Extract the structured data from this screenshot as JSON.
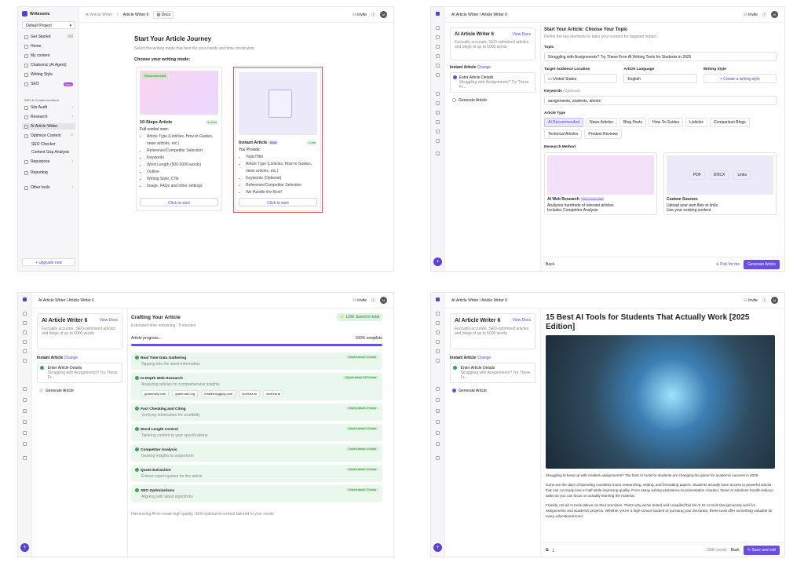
{
  "p1": {
    "logo": "Writesonic",
    "project": "Default Project",
    "nav": {
      "get_started": "Get Started",
      "get_started_count": "0/8",
      "home": "Home",
      "my_content": "My content",
      "chatsonic": "Chatsonic (Ai Agent)",
      "writing_style": "Writing Style",
      "seo": "SEO",
      "seo_badge": "New",
      "section": "SEO & Content workflow",
      "site_audit": "Site Audit",
      "research": "Research",
      "ai_article_writer": "AI Article Writer",
      "optimize": "Optimize Content",
      "seo_checker": "SEO Checker",
      "content_gap": "Content Gap Analysis",
      "repurpose": "Repurpose",
      "reporting": "Reporting",
      "other_tools": "Other tools",
      "upgrade": "Upgrade now"
    },
    "top": {
      "crumb1": "AI Article Writer",
      "crumb2": "Article Writer 6",
      "docs": "Docs",
      "invite": "Invite",
      "avatar": "M"
    },
    "title": "Start Your Article Journey",
    "subtitle": "Select the writing mode that best fits your needs and time constraints",
    "choose": "Choose your writing mode:",
    "card1": {
      "badge": "Recommended",
      "title": "10-Steps Article",
      "time": "5 mins",
      "lead": "Full control over:",
      "items": [
        "Article Type (Listicles, How-to Guides, news articles, etc.)",
        "Reference/Competitor Selection",
        "Keywords",
        "Word Length (500-5000 words)",
        "Outline",
        "Writing Style, CTA",
        "Image, FAQs and other settings"
      ],
      "button": "Click to start"
    },
    "card2": {
      "title": "Instant Article",
      "tag": "Beta",
      "time": "1 min",
      "lead": "You Provide:",
      "items": [
        "Topic/Title",
        "Article Type (Listicles, How-to Guides, news articles, etc.)",
        "Keywords (Optional)",
        "Reference/Competitor Selection",
        "We Handle the Rest!"
      ],
      "button": "Click to start"
    }
  },
  "p2": {
    "crumb": "AI Article Writer / Article Writer 6",
    "invite": "Invite",
    "avatar": "M",
    "side": {
      "title": "AI Article Writer 6",
      "view_docs": "View Docs",
      "desc": "Factually accurate, SEO-optimized articles and blogs of up to 5000 words",
      "mode": "Instant Article",
      "change": "Change",
      "step1": "Enter Article Details",
      "step1_sub": "Struggling with Assignments? Try These Fr...",
      "step2": "Generate Article"
    },
    "title": "Start Your Article: Choose Your Topic",
    "subtitle": "Define the key elements to tailor your content for targeted impact",
    "topic_label": "Topic",
    "topic": "Struggling with Assignments? Try These Free AI Writing Tools for Students in 2025",
    "audience_label": "Target Audience Location",
    "audience": "United States",
    "lang_label": "Article Language",
    "lang": "English",
    "style_label": "Writing Style",
    "style": "Create a writing style",
    "kw_label": "Keywords",
    "kw_opt": "(Optional)",
    "keywords": "assignments, students, aitools",
    "type_label": "Article Type",
    "types": [
      "AI Recommended",
      "News Articles",
      "Blog Posts",
      "How-To Guides",
      "Listicles",
      "Comparison Blogs",
      "Technical Articles",
      "Product Reviews"
    ],
    "research_label": "Research Method",
    "rm1": {
      "title": "AI Web Research",
      "tag": "Recommended",
      "items": [
        "Analyzes hundreds of relevant articles",
        "Includes Competitor Analysis"
      ]
    },
    "rm2": {
      "title": "Custom Sources",
      "items": [
        "Upload your own files or links",
        "Use your existing content"
      ],
      "chips": [
        "PDF",
        "DOCX",
        "Links"
      ]
    },
    "back": "Back",
    "pick": "Pick for me",
    "generate": "Generate Article"
  },
  "p3": {
    "crumb": "AI Article Writer / Article Writer 6",
    "invite": "Invite",
    "avatar": "M",
    "side": {
      "title": "AI Article Writer 6",
      "view_docs": "View Docs",
      "desc": "Factually accurate, SEO-optimized articles and blogs of up to 5000 words",
      "mode": "Instant Article",
      "change": "Change",
      "step1": "Enter Article Details",
      "step1_sub": "Struggling with Assignments? Try These Fr...",
      "step2": "Generate Article"
    },
    "title": "Crafting Your Article",
    "saved": "120h Saved in total",
    "estimate": "Estimated time remaining : 5 minutes",
    "progress_label": "Article progress...",
    "progress_pct": "100% complete",
    "progress": 1.0,
    "sections": [
      {
        "title": "Real Time Data Gathering",
        "desc": "Tapping into the latest information",
        "saved": "Saved about 3 hours"
      },
      {
        "title": "In-Depth Web Research",
        "desc": "Analyzing articles for comprehensive insights",
        "saved": "Saved about 112 hours"
      },
      {
        "title": "Fact Checking and Citing",
        "desc": "Verifying information for credibility",
        "saved": "Saved about 2 hours"
      },
      {
        "title": "Word Length Control",
        "desc": "Tailoring content to your specifications",
        "saved": "Saved about 2 hours"
      },
      {
        "title": "Competitor Analysis",
        "desc": "Gaining insights to outperform",
        "saved": "Saved about 4 hours"
      },
      {
        "title": "Quote Extraction",
        "desc": "Extract expert quotes for the article",
        "saved": "Saved about 2 hours"
      },
      {
        "title": "SEO Optimizations",
        "desc": "Aligning with latest algorithms",
        "saved": "Saved about 2 hours"
      }
    ],
    "sites": [
      "grammarly.com",
      "grammark.org",
      "masterblogging.com",
      "doctrina.ai",
      "doctrina.ai"
    ],
    "footer": "Harnessing AI to create high quality, SEO-optimized content tailored to your needs"
  },
  "p4": {
    "crumb": "AI Article Writer / Article Writer 6",
    "invite": "Invite",
    "avatar": "M",
    "side": {
      "title": "AI Article Writer 6",
      "view_docs": "View Docs",
      "desc": "Factually accurate, SEO-optimized articles and blogs of up to 5000 words",
      "mode": "Instant Article",
      "change": "Change",
      "step1": "Enter Article Details",
      "step1_sub": "Struggling with Assignments? Try These Fr...",
      "step2": "Generate Article"
    },
    "headline": "15 Best AI Tools for Students That Actually Work [2025 Edition]",
    "para1": "Struggling to keep up with endless assignments? The best AI tools for students are changing the game for academic success in 2025.",
    "para2": "Gone are the days of spending countless hours researching, writing, and formatting papers. Students actually have access to powerful aitools that can cut study time in half while improving quality. From essay writing assistance to presentation creation, these AI solutions handle tedious tasks so you can focus on actually learning the material.",
    "para3": "Frankly, not all AI tools deliver on their promises. That's why we've tested and compiled this list of 15 AI tools that genuinely work for assignments and academic projects. Whether you're a high school student or pursuing your doctorate, these tools offer something valuable for every educational level.",
    "words": "5585 words",
    "back": "Back",
    "save": "Save and edit"
  }
}
